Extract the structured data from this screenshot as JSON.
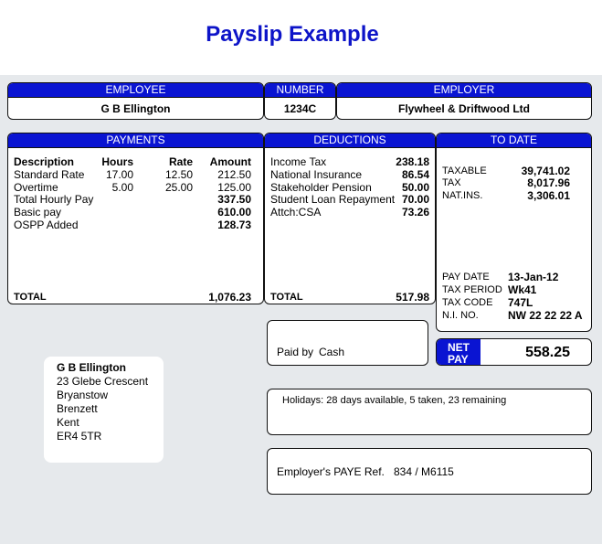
{
  "title": "Payslip Example",
  "employee": {
    "header": "EMPLOYEE",
    "name": "G B Ellington"
  },
  "number": {
    "header": "NUMBER",
    "value": "1234C"
  },
  "employer": {
    "header": "EMPLOYER",
    "name": "Flywheel & Driftwood Ltd"
  },
  "payments": {
    "header": "PAYMENTS",
    "columns": [
      "Description",
      "Hours",
      "Rate",
      "Amount"
    ],
    "rows": [
      {
        "desc": "Standard Rate",
        "hours": "17.00",
        "rate": "12.50",
        "amount": "212.50"
      },
      {
        "desc": "Overtime",
        "hours": "5.00",
        "rate": "25.00",
        "amount": "125.00"
      },
      {
        "desc": "Total Hourly Pay",
        "hours": "",
        "rate": "",
        "amount": "337.50"
      },
      {
        "desc": "Basic pay",
        "hours": "",
        "rate": "",
        "amount": "610.00"
      },
      {
        "desc": "OSPP Added",
        "hours": "",
        "rate": "",
        "amount": "128.73"
      }
    ],
    "total_label": "TOTAL",
    "total_value": "1,076.23"
  },
  "deductions": {
    "header": "DEDUCTIONS",
    "rows": [
      {
        "desc": "Income Tax",
        "amount": "238.18"
      },
      {
        "desc": "National Insurance",
        "amount": "86.54"
      },
      {
        "desc": "Stakeholder Pension",
        "amount": "50.00"
      },
      {
        "desc": "Student Loan Repayment",
        "amount": "70.00"
      },
      {
        "desc": "Attch:CSA",
        "amount": "73.26"
      }
    ],
    "total_label": "TOTAL",
    "total_value": "517.98"
  },
  "to_date": {
    "header": "TO DATE",
    "rows": [
      {
        "label": "TAXABLE",
        "value": "39,741.02"
      },
      {
        "label": "TAX",
        "value": "8,017.96"
      },
      {
        "label": "NAT.INS.",
        "value": "3,306.01"
      }
    ],
    "info": [
      {
        "label": "PAY DATE",
        "value": "13-Jan-12"
      },
      {
        "label": "TAX PERIOD",
        "value": "Wk41"
      },
      {
        "label": "TAX CODE",
        "value": "747L"
      },
      {
        "label": "N.I. NO.",
        "value": "NW 22 22 22 A"
      }
    ]
  },
  "paid_by": {
    "label": "Paid by",
    "method": "Cash"
  },
  "net_pay": {
    "label_line1": "NET",
    "label_line2": "PAY",
    "value": "558.25"
  },
  "holidays": "Holidays: 28 days available, 5 taken, 23 remaining",
  "paye_ref": {
    "label": "Employer's PAYE Ref.",
    "value": "834 / M6115"
  },
  "address": [
    "G B Ellington",
    "23 Glebe Crescent",
    "Bryanstow",
    "Brenzett",
    "Kent",
    "ER4 5TR"
  ],
  "colors": {
    "header_blue": "#0a14d2",
    "title_blue": "#0d14c8",
    "panel_grey": "#e6e9ec"
  }
}
